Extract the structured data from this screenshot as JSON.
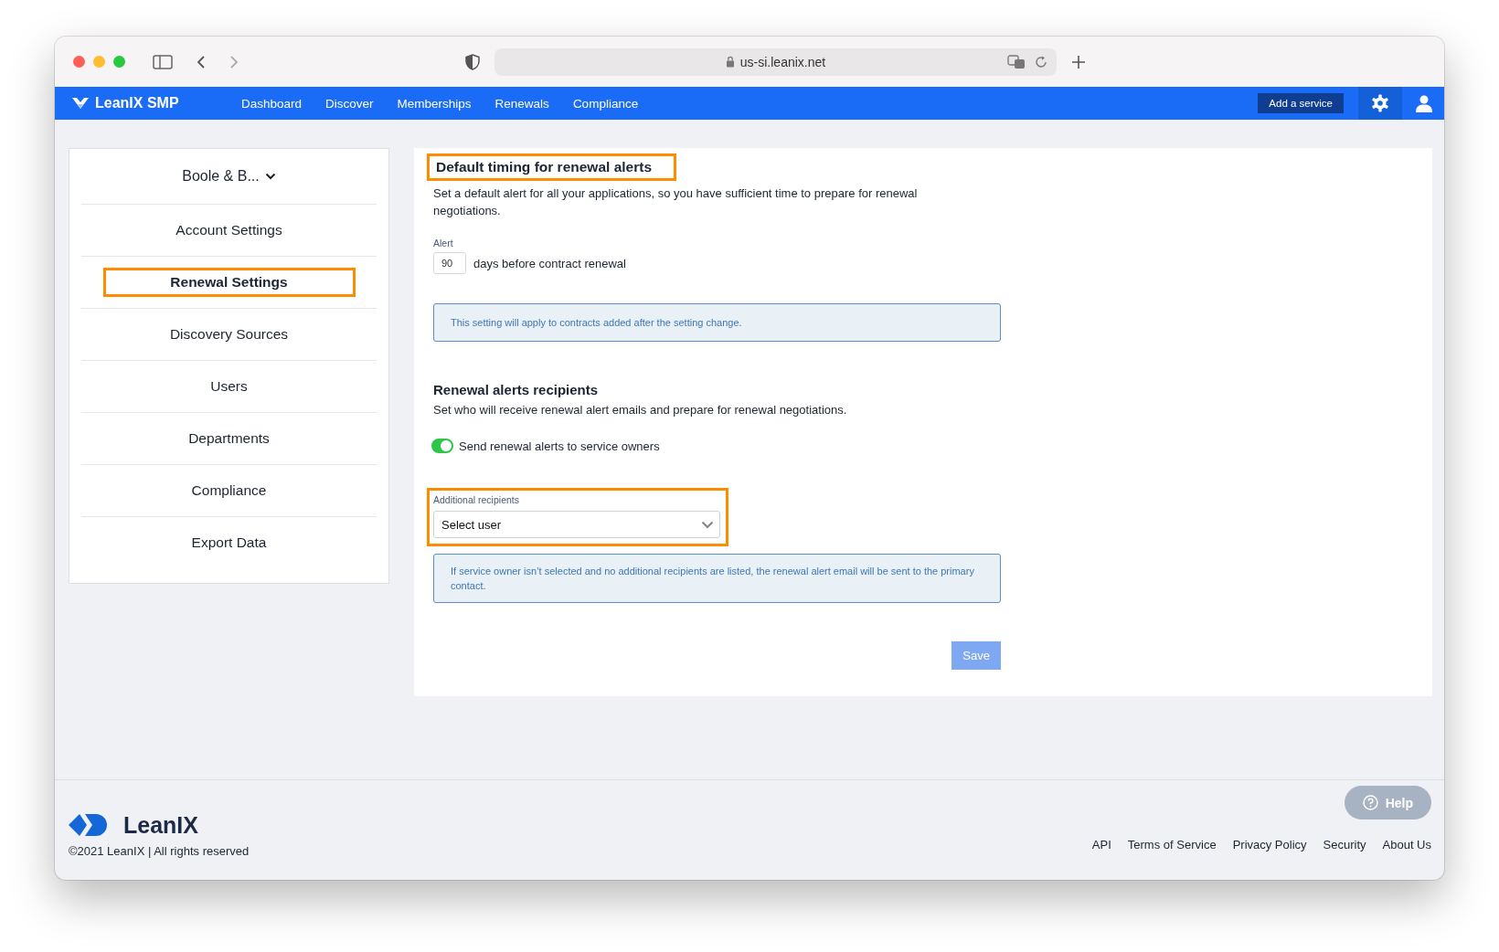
{
  "browser": {
    "url": "us-si.leanix.net"
  },
  "navbar": {
    "brand": "LeanIX SMP",
    "links": [
      {
        "label": "Dashboard"
      },
      {
        "label": "Discover"
      },
      {
        "label": "Memberships"
      },
      {
        "label": "Renewals"
      },
      {
        "label": "Compliance"
      }
    ],
    "add_button": "Add a service"
  },
  "sidebar": {
    "account": "Boole & B...",
    "items": [
      {
        "label": "Account Settings",
        "selected": false
      },
      {
        "label": "Renewal Settings",
        "selected": true
      },
      {
        "label": "Discovery Sources",
        "selected": false
      },
      {
        "label": "Users",
        "selected": false
      },
      {
        "label": "Departments",
        "selected": false
      },
      {
        "label": "Compliance",
        "selected": false
      },
      {
        "label": "Export Data",
        "selected": false
      }
    ]
  },
  "timing": {
    "title": "Default timing for renewal alerts",
    "description": "Set a default alert for all your applications, so you have sufficient time to prepare for renewal negotiations.",
    "alert_label": "Alert",
    "alert_value": "90",
    "alert_suffix": "days before contract renewal",
    "info": "This setting will apply to contracts added after the setting change."
  },
  "recipients": {
    "title": "Renewal alerts recipients",
    "description": "Set who will receive renewal alert emails and prepare for renewal negotiations.",
    "toggle": {
      "label": "Send renewal alerts to service owners",
      "on": true
    },
    "additional_label": "Additional recipients",
    "select_placeholder": "Select user",
    "info": "If service owner isn’t selected and no additional recipients are listed, the renewal alert email will be sent to the primary contact."
  },
  "save_button": {
    "label": "Save",
    "disabled": true
  },
  "footer": {
    "logo": "LeanIX",
    "copyright": "©2021 LeanIX | All rights reserved",
    "help": "Help",
    "links": [
      "API",
      "Terms of Service",
      "Privacy Policy",
      "Security",
      "About Us"
    ]
  }
}
